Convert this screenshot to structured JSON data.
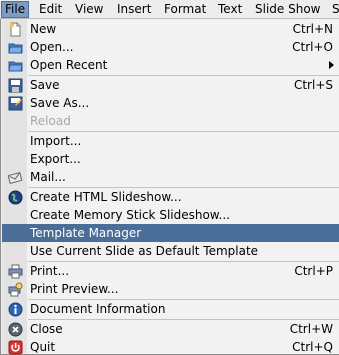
{
  "menubar": {
    "items": [
      "File",
      "Edit",
      "View",
      "Insert",
      "Format",
      "Text",
      "Slide Show",
      "S"
    ]
  },
  "file_menu": {
    "items": [
      {
        "label": "New",
        "shortcut": "Ctrl+N",
        "icon": "new-document-icon"
      },
      {
        "label": "Open...",
        "shortcut": "Ctrl+O",
        "icon": "open-folder-icon"
      },
      {
        "label": "Open Recent",
        "shortcut": "",
        "icon": "open-recent-icon",
        "submenu": true
      },
      {
        "label": "Save",
        "shortcut": "Ctrl+S",
        "icon": "save-icon"
      },
      {
        "label": "Save As...",
        "shortcut": "",
        "icon": "save-as-icon"
      },
      {
        "label": "Reload",
        "shortcut": "",
        "icon": "",
        "disabled": true
      },
      {
        "label": "Import...",
        "shortcut": "",
        "icon": ""
      },
      {
        "label": "Export...",
        "shortcut": "",
        "icon": ""
      },
      {
        "label": "Mail...",
        "shortcut": "",
        "icon": "mail-icon"
      },
      {
        "label": "Create HTML Slideshow...",
        "shortcut": "",
        "icon": "globe-icon"
      },
      {
        "label": "Create Memory Stick Slideshow...",
        "shortcut": "",
        "icon": ""
      },
      {
        "label": "Template Manager",
        "shortcut": "",
        "icon": "",
        "highlighted": true
      },
      {
        "label": "Use Current Slide as Default Template",
        "shortcut": "",
        "icon": ""
      },
      {
        "label": "Print...",
        "shortcut": "Ctrl+P",
        "icon": "printer-icon"
      },
      {
        "label": "Print Preview...",
        "shortcut": "",
        "icon": "print-preview-icon"
      },
      {
        "label": "Document Information",
        "shortcut": "",
        "icon": "info-icon"
      },
      {
        "label": "Close",
        "shortcut": "Ctrl+W",
        "icon": "close-icon"
      },
      {
        "label": "Quit",
        "shortcut": "Ctrl+Q",
        "icon": "quit-icon"
      }
    ]
  }
}
